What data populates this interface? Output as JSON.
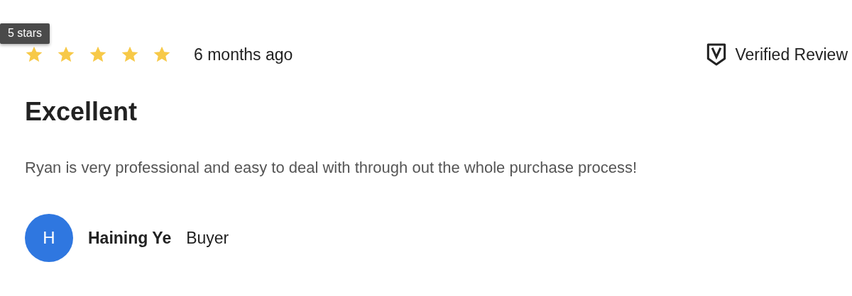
{
  "tooltip": "5 stars",
  "review": {
    "stars": 5,
    "time": "6 months ago",
    "verified": "Verified Review",
    "title": "Excellent",
    "body": "Ryan is very professional and easy to deal with through out the whole purchase process!"
  },
  "author": {
    "initial": "H",
    "name": "Haining Ye",
    "role": "Buyer"
  }
}
